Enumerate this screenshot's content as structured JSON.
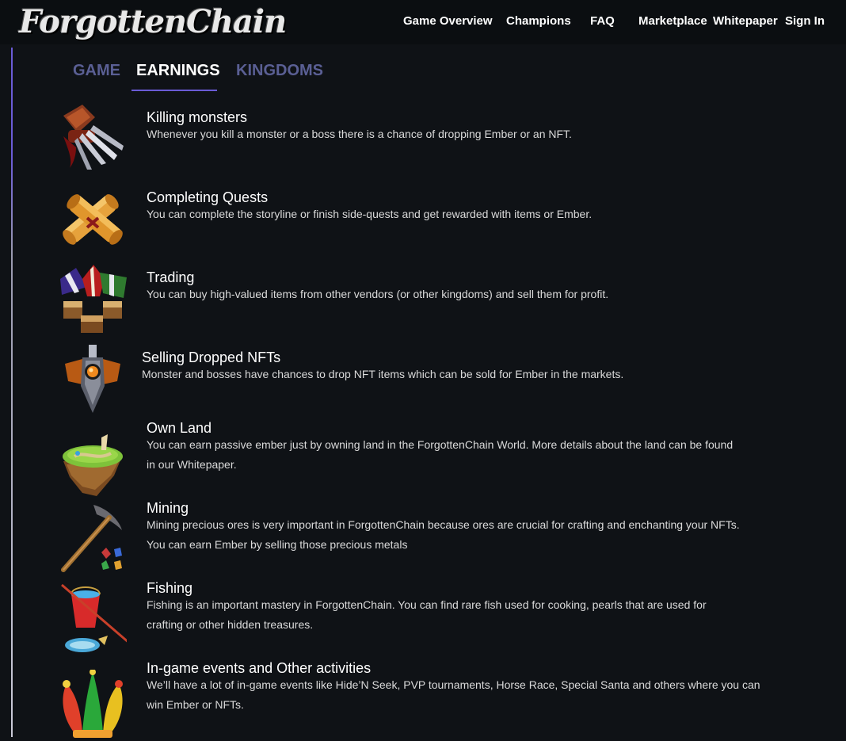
{
  "header": {
    "logo_text": "ForgottenChain",
    "nav": {
      "game_overview": "Game Overview",
      "champions": "Champions",
      "faq": "FAQ",
      "marketplace": "Marketplace",
      "whitepaper": "Whitepaper",
      "sign_in": "Sign In"
    }
  },
  "tabs": {
    "game": "GAME",
    "earnings": "EARNINGS",
    "kingdoms": "KINGDOMS",
    "active": "EARNINGS"
  },
  "colors": {
    "background": "#0f1216",
    "topbar": "#0b0e11",
    "accent": "#6a5bd6",
    "inactive_tab": "#5a5f94",
    "text": "#ffffff",
    "muted_text": "#dadada"
  },
  "earnings": {
    "items": [
      {
        "icon": "claw-gauntlet-icon",
        "title": "Killing monsters",
        "desc1": "Whenever you kill a monster or a boss there is a chance of dropping Ember or an NFT.",
        "desc2": ""
      },
      {
        "icon": "scroll-icon",
        "title": "Completing Quests",
        "desc1": "You can complete the storyline or finish side-quests and get rewarded with items or Ember.",
        "desc2": ""
      },
      {
        "icon": "market-tents-icon",
        "title": "Trading",
        "desc1": "You can buy high-valued items from other vendors (or other kingdoms) and sell them for profit.",
        "desc2": ""
      },
      {
        "icon": "winged-shield-icon",
        "title": "Selling Dropped NFTs",
        "desc1": "Monster and bosses have chances to drop NFT items which can be sold for Ember in the markets.",
        "desc2": ""
      },
      {
        "icon": "floating-island-icon",
        "title": "Own Land",
        "desc1": "You can earn passive ember just by owning land in the ForgottenChain World. More details about the land can be found",
        "desc2": "in our Whitepaper."
      },
      {
        "icon": "pickaxe-ores-icon",
        "title": "Mining",
        "desc1": "Mining precious ores is very important in ForgottenChain because ores are crucial for crafting and enchanting your NFTs.",
        "desc2": "You can earn Ember by selling those precious metals"
      },
      {
        "icon": "bucket-fishing-icon",
        "title": "Fishing",
        "desc1": "Fishing is an important mastery in ForgottenChain. You can find rare fish used for cooking, pearls that are used for",
        "desc2": "crafting or other hidden treasures."
      },
      {
        "icon": "jester-hat-icon",
        "title": "In-game events and Other activities",
        "desc1": "We’ll have a lot of in-game events like Hide’N Seek, PVP tournaments, Horse Race, Special Santa and others where you can",
        "desc2": "win Ember or NFTs."
      }
    ]
  }
}
